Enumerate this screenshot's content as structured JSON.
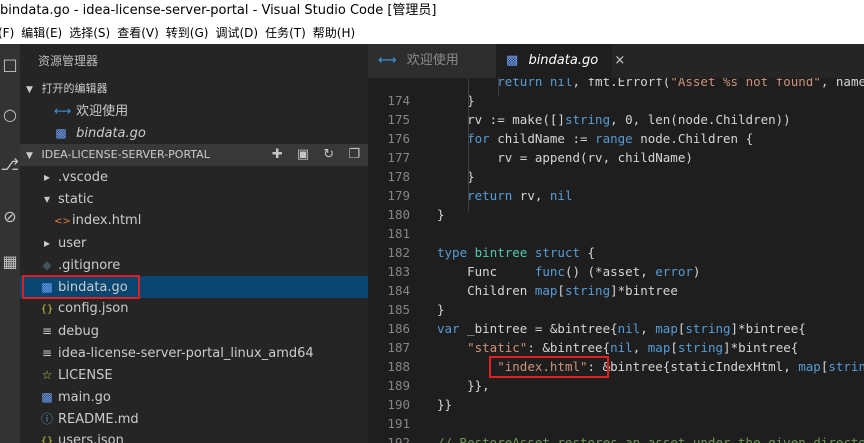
{
  "window": {
    "title": "bindata.go - idea-license-server-portal - Visual Studio Code [管理员]"
  },
  "menu": [
    "(F)",
    "编辑(E)",
    "选择(S)",
    "查看(V)",
    "转到(G)",
    "调试(D)",
    "任务(T)",
    "帮助(H)"
  ],
  "sidebar": {
    "title": "资源管理器",
    "open_editors_label": "打开的编辑器",
    "open_editors": [
      {
        "label": "欢迎使用",
        "icon": "vscode-icon"
      },
      {
        "label": "bindata.go",
        "icon": "go-file-icon"
      }
    ],
    "project_label": "IDEA-LICENSE-SERVER-PORTAL",
    "files": [
      {
        "label": ".vscode",
        "icon": "chevron-right-icon"
      },
      {
        "label": "static",
        "icon": "chevron-down-icon"
      },
      {
        "label": "index.html",
        "icon": "html-file-icon"
      },
      {
        "label": "user",
        "icon": "chevron-right-icon"
      },
      {
        "label": ".gitignore",
        "icon": "git-icon"
      },
      {
        "label": "bindata.go",
        "icon": "go-file-icon"
      },
      {
        "label": "config.json",
        "icon": "json-icon"
      },
      {
        "label": "debug",
        "icon": "file-lines-icon"
      },
      {
        "label": "idea-license-server-portal_linux_amd64",
        "icon": "file-lines-icon"
      },
      {
        "label": "LICENSE",
        "icon": "license-icon"
      },
      {
        "label": "main.go",
        "icon": "go-file-icon"
      },
      {
        "label": "README.md",
        "icon": "info-icon"
      },
      {
        "label": "users.json",
        "icon": "json-icon"
      }
    ]
  },
  "tabs": [
    {
      "label": "欢迎使用",
      "active": false
    },
    {
      "label": "bindata.go",
      "active": true,
      "close": "×"
    }
  ],
  "code": {
    "lines": [
      {
        "n": "",
        "text": "        return nil, fmt.Errorf(\"Asset %s not found\", name)"
      },
      {
        "n": "174",
        "text": "    }"
      },
      {
        "n": "175",
        "text": "    rv := make([]string, 0, len(node.Children))"
      },
      {
        "n": "176",
        "text": "    for childName := range node.Children {"
      },
      {
        "n": "177",
        "text": "        rv = append(rv, childName)"
      },
      {
        "n": "178",
        "text": "    }"
      },
      {
        "n": "179",
        "text": "    return rv, nil"
      },
      {
        "n": "180",
        "text": "}"
      },
      {
        "n": "181",
        "text": ""
      },
      {
        "n": "182",
        "text": "type bintree struct {"
      },
      {
        "n": "183",
        "text": "    Func     func() (*asset, error)"
      },
      {
        "n": "184",
        "text": "    Children map[string]*bintree"
      },
      {
        "n": "185",
        "text": "}"
      },
      {
        "n": "186",
        "text": "var _bintree = &bintree{nil, map[string]*bintree{"
      },
      {
        "n": "187",
        "text": "    \"static\": &bintree{nil, map[string]*bintree{"
      },
      {
        "n": "188",
        "text": "        \"index.html\": &bintree{staticIndexHtml, map[string]*bintree{}},"
      },
      {
        "n": "189",
        "text": "    }},"
      },
      {
        "n": "190",
        "text": "}}"
      },
      {
        "n": "191",
        "text": ""
      },
      {
        "n": "192",
        "text": "// RestoreAsset restores an asset under the given directory"
      }
    ]
  },
  "colors": {
    "keyword": "#569cd6",
    "string": "#ce9178",
    "type": "#4ec9b0",
    "comment": "#6a9955",
    "highlight": "#e02020"
  }
}
